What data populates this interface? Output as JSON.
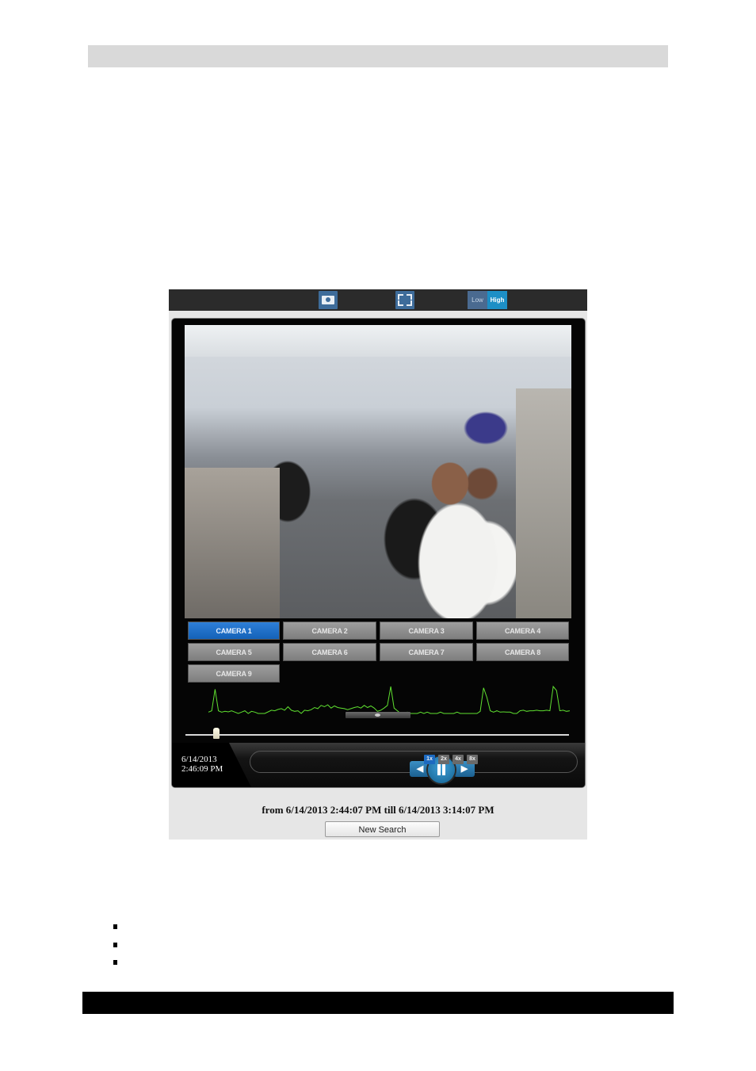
{
  "toolbar": {
    "snapshot_icon": "camera-snapshot-icon",
    "fullscreen_icon": "fullscreen-icon",
    "quality": {
      "options": [
        "Low",
        "High"
      ],
      "selected": "High"
    }
  },
  "colors": {
    "toolbar_bg": "#2b2b2b",
    "button_blue": "#3e6c9a",
    "active_blue": "#1d8fc6",
    "camera_active": "#1462b8",
    "activity_green": "#5fe030"
  },
  "cameras": [
    {
      "label": "Camera 1",
      "active": true
    },
    {
      "label": "Camera 2",
      "active": false
    },
    {
      "label": "Camera 3",
      "active": false
    },
    {
      "label": "Camera 4",
      "active": false
    },
    {
      "label": "Camera 5",
      "active": false
    },
    {
      "label": "Camera 6",
      "active": false
    },
    {
      "label": "Camera 7",
      "active": false
    },
    {
      "label": "Camera 8",
      "active": false
    },
    {
      "label": "Camera 9",
      "active": false
    }
  ],
  "activity_graph": {
    "levels": [
      0.05,
      0.1,
      0.9,
      0.1,
      0.05,
      0.08,
      0.06,
      0.1,
      0.05,
      0,
      0.05,
      0.1,
      0,
      0.08,
      0.05,
      0,
      0,
      0,
      0.06,
      0.12,
      0.1,
      0.15,
      0.18,
      0.12,
      0.25,
      0.12,
      0.08,
      0.1,
      0,
      0.12,
      0.1,
      0.14,
      0.22,
      0.18,
      0.3,
      0.25,
      0.32,
      0.2,
      0.28,
      0.22,
      0.2,
      0.18,
      0.14,
      0.18,
      0.22,
      0.25,
      0.2,
      0.3,
      0.22,
      0.28,
      0.2,
      0.08,
      0.12,
      0.2,
      0.3,
      1.0,
      0.2,
      0.1,
      0,
      0,
      0.05,
      0,
      0,
      0,
      0.05,
      0,
      0.05,
      0,
      0,
      0,
      0.05,
      0,
      0,
      0,
      0,
      0.05,
      0,
      0,
      0,
      0,
      0,
      0,
      0.08,
      0.95,
      0.6,
      0.1,
      0.05,
      0.1,
      0.05,
      0.06,
      0.05,
      0.05,
      0,
      0,
      0.1,
      0.12,
      0.08,
      0.1,
      0.1,
      0.12,
      0.1,
      0.1,
      0.12,
      0.1,
      1.0,
      0.85,
      0.1,
      0.12,
      0.08,
      0.1
    ],
    "playback_position": 0.08
  },
  "playback": {
    "current_date": "6/14/2013",
    "current_time": "2:46:09 PM",
    "prev_icon": "step-back-icon",
    "pause_icon": "pause-icon",
    "next_icon": "step-forward-icon",
    "speeds": [
      {
        "label": "1x",
        "active": true
      },
      {
        "label": "2x",
        "active": false
      },
      {
        "label": "4x",
        "active": false
      },
      {
        "label": "8x",
        "active": false
      }
    ]
  },
  "search": {
    "range_text": "from 6/14/2013 2:44:07 PM till 6/14/2013 3:14:07 PM",
    "new_search_label": "New Search"
  },
  "bullets_count": 3
}
